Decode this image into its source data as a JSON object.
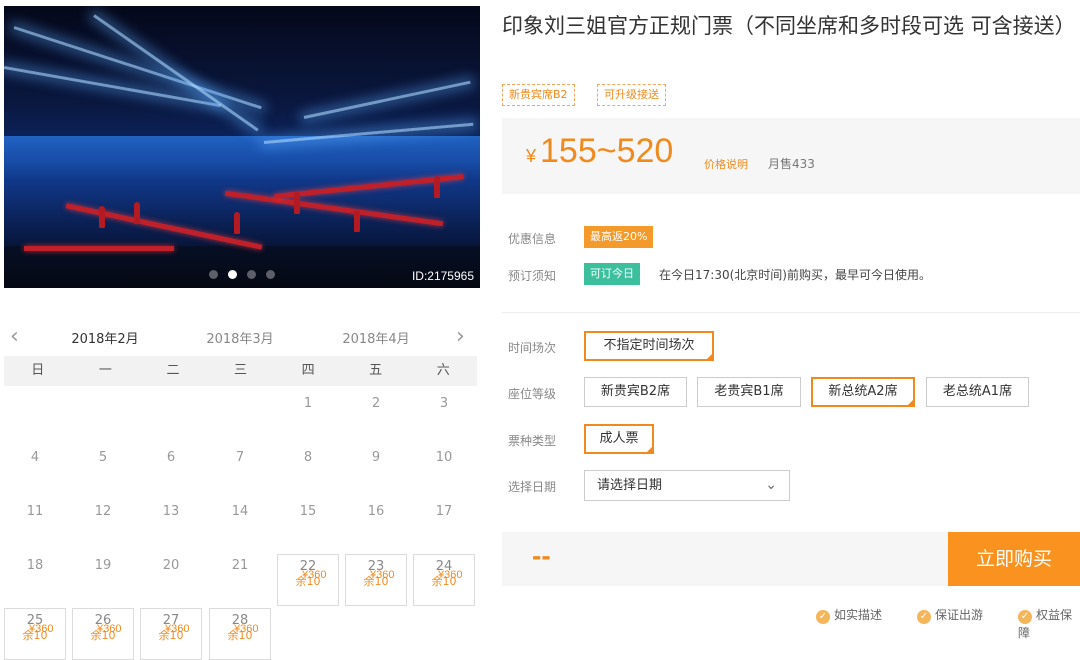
{
  "photo": {
    "image_id": "ID:2175965",
    "slide_count": 4,
    "active_slide": 2
  },
  "calendar": {
    "prev_symbol": "‹",
    "next_symbol": "›",
    "months": [
      "2018年2月",
      "2018年3月",
      "2018年4月"
    ],
    "active_month": 0,
    "weekdays": [
      "日",
      "一",
      "二",
      "三",
      "四",
      "五",
      "六"
    ],
    "first_weekday": 4,
    "days_in_month": 28,
    "available_from": 22,
    "price_text": "¥360",
    "remain_text": "余10"
  },
  "product": {
    "title": "印象刘三姐官方正规门票（不同坐席和多时段可选 可含接送）",
    "tags": [
      "新贵宾席B2",
      "可升级接送"
    ],
    "currency": "¥",
    "price_range": "155~520",
    "price_note": "价格说明",
    "monthly_sales": "月售433"
  },
  "info": {
    "discount_label": "优惠信息",
    "discount_badge": "最高返20%",
    "booking_label": "预订须知",
    "booking_badge": "可订今日",
    "booking_text": "在今日17:30(北京时间)前购买，最早可今日使用。"
  },
  "options": {
    "time_label": "时间场次",
    "time_value": "不指定时间场次",
    "seat_label": "座位等级",
    "seats": [
      "新贵宾B2席",
      "老贵宾B1席",
      "新总统A2席",
      "老总统A1席"
    ],
    "selected_seat": 2,
    "ticket_label": "票种类型",
    "ticket_value": "成人票",
    "date_label": "选择日期",
    "date_placeholder": "请选择日期",
    "chevron": "⌄"
  },
  "purchase": {
    "total": "--",
    "buy_label": "立即购买"
  },
  "guarantees": [
    "如实描述",
    "保证出游",
    "权益保障"
  ],
  "colors": {
    "accent": "#f08a1e",
    "buy_button": "#f9921f",
    "green": "#3bbf9d"
  }
}
